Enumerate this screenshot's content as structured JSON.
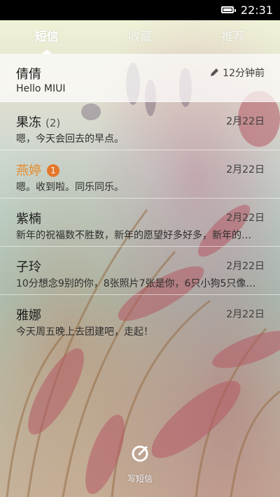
{
  "status": {
    "time": "22:31"
  },
  "tabs": [
    {
      "label": "短信",
      "active": true
    },
    {
      "label": "收藏",
      "active": false
    },
    {
      "label": "推荐",
      "active": false
    }
  ],
  "conversations": [
    {
      "name": "倩倩",
      "count": "",
      "unread": "",
      "preview": "Hello MIUI",
      "time": "12分钟前",
      "draft": true
    },
    {
      "name": "果冻",
      "count": "(2)",
      "unread": "",
      "preview": "嗯，今天会回去的早点。",
      "time": "2月22日",
      "draft": false
    },
    {
      "name": "燕婷",
      "count": "",
      "unread": "1",
      "preview": "嗯。收到啦。同乐同乐。",
      "time": "2月22日",
      "draft": false
    },
    {
      "name": "紫楠",
      "count": "",
      "unread": "",
      "preview": "新年的祝福数不胜数，新年的愿望好多好多，新年的…",
      "time": "2月22日",
      "draft": false
    },
    {
      "name": "子玲",
      "count": "",
      "unread": "",
      "preview": "10分想念9别的你，8张照片7张是你，6只小狗5只像…",
      "time": "2月22日",
      "draft": false
    },
    {
      "name": "雅娜",
      "count": "",
      "unread": "",
      "preview": "今天周五晚上去团建吧，走起！",
      "time": "2月22日",
      "draft": false
    }
  ],
  "compose": {
    "label": "写短信",
    "icon": "compose-icon"
  },
  "colors": {
    "unread_accent": "#e5892b",
    "badge": "#e5772a"
  }
}
